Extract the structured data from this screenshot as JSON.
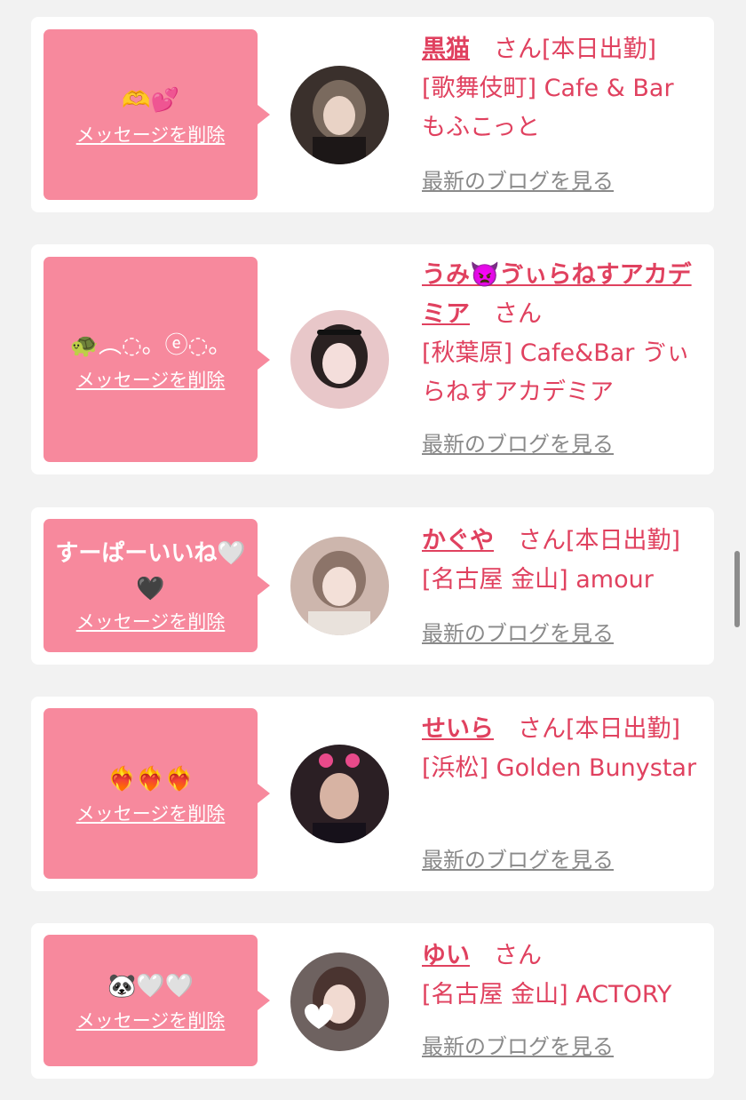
{
  "delete_label": "メッセージを削除",
  "blog_label": "最新のブログを見る",
  "accent_color": "#e0415f",
  "bubble_color": "#f7899d",
  "cards": [
    {
      "message": "🫶💕",
      "name": "黒猫",
      "suffix": "　さん",
      "status": "[本日出勤]",
      "shop": "[歌舞伎町] Cafe & Bar もふこっと"
    },
    {
      "message": "🐢︵◌。ⓔ◌。",
      "name": "うみ👿ゔぃらねすアカデミア",
      "suffix": "　さん",
      "status": "",
      "shop": "[秋葉原] Cafe&Bar ゔぃらねすアカデミア"
    },
    {
      "message": "すーぱーいいね🤍🖤",
      "name": "かぐや",
      "suffix": "　さん",
      "status": "[本日出勤]",
      "shop": "[名古屋 金山] amour"
    },
    {
      "message": "❤️‍🔥❤️‍🔥❤️‍🔥",
      "name": "せいら",
      "suffix": "　さん",
      "status": "[本日出勤]",
      "shop": "[浜松] Golden Bunystar"
    },
    {
      "message": "🐼🤍🤍",
      "name": "ゆい",
      "suffix": "　さん",
      "status": "",
      "shop": "[名古屋 金山] ACTORY"
    }
  ]
}
